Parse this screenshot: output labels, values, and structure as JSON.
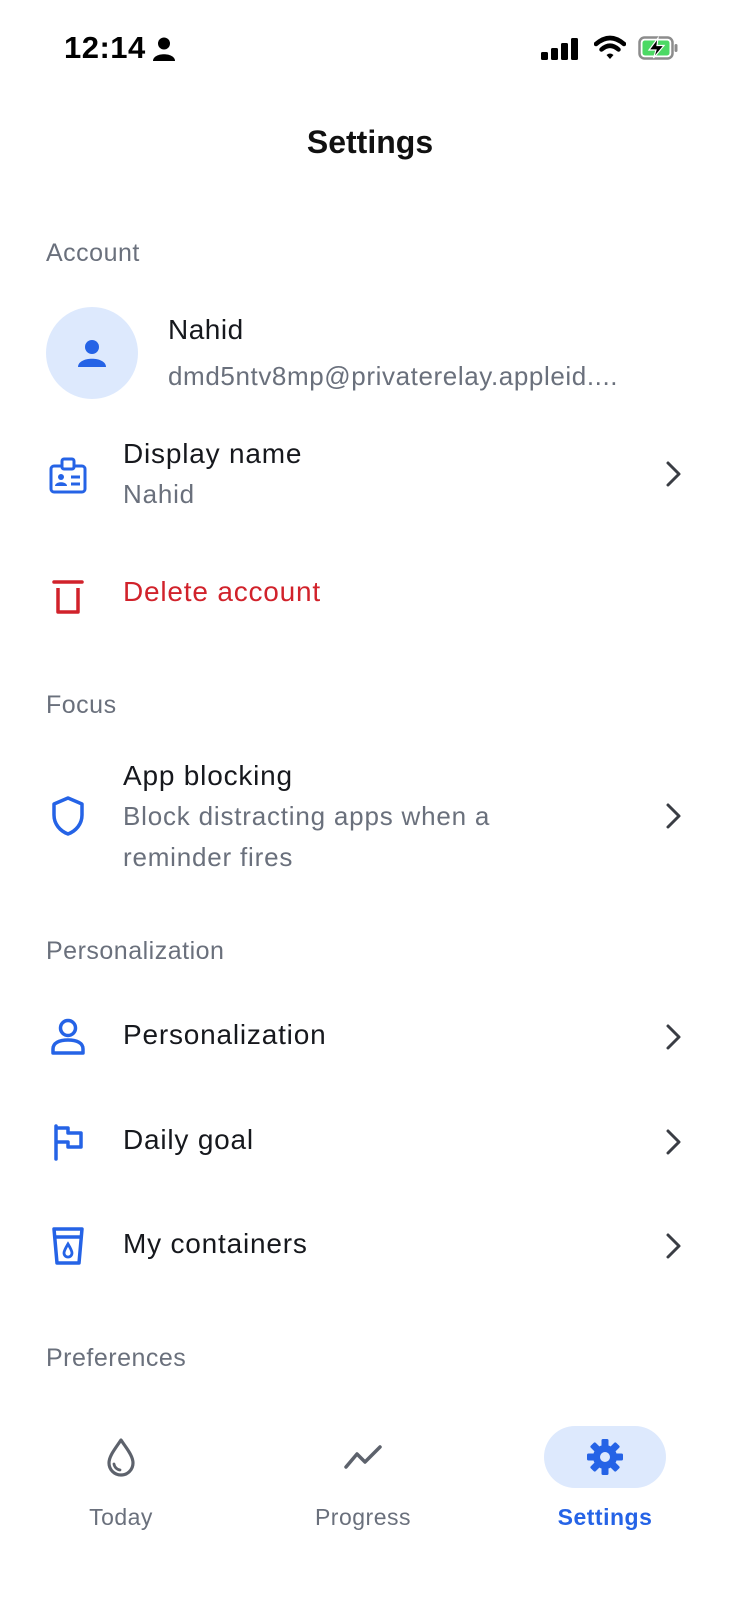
{
  "status_bar": {
    "time": "12:14"
  },
  "header": {
    "title": "Settings"
  },
  "sections": {
    "account": "Account",
    "focus": "Focus",
    "personalization": "Personalization",
    "preferences": "Preferences"
  },
  "account": {
    "name": "Nahid",
    "email": "dmd5ntv8mp@privaterelay.appleid...."
  },
  "rows": {
    "display_name": {
      "title": "Display name",
      "subtitle": "Nahid"
    },
    "delete_account": {
      "title": "Delete account"
    },
    "app_blocking": {
      "title": "App blocking",
      "subtitle_line1": "Block distracting apps when a",
      "subtitle_line2": "reminder fires"
    },
    "personalization": {
      "title": "Personalization"
    },
    "daily_goal": {
      "title": "Daily goal"
    },
    "my_containers": {
      "title": "My containers"
    }
  },
  "nav": {
    "today": "Today",
    "progress": "Progress",
    "settings": "Settings",
    "active": "settings"
  },
  "colors": {
    "accent": "#2563e6",
    "accent_soft": "#dde9fd",
    "danger": "#d1222b",
    "muted_text": "#6a707c"
  }
}
